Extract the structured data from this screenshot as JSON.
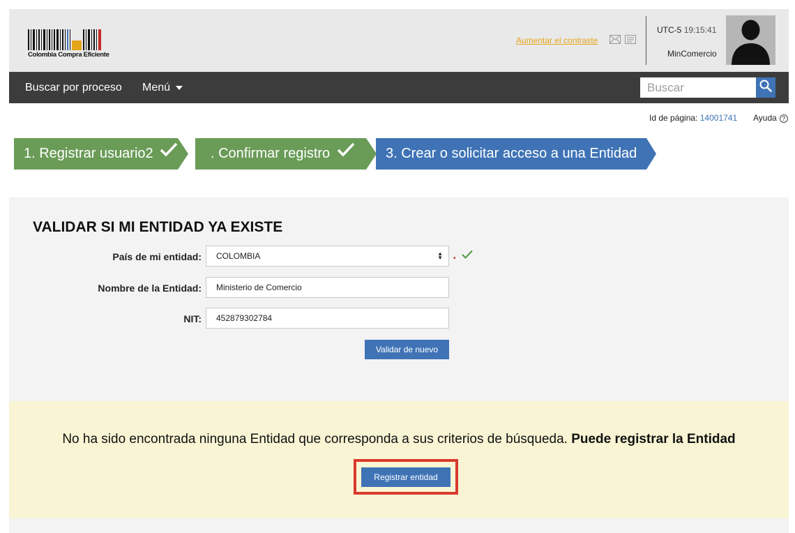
{
  "header": {
    "logo_text": "Colombia Compra Eficiente",
    "contrast_link": "Aumentar el contraste",
    "timezone": "UTC-5",
    "time": "19:15:41",
    "user_name": "MinComercio",
    "icons": [
      "mail-icon",
      "document-icon",
      "avatar-icon"
    ]
  },
  "nav": {
    "search_process": "Buscar por proceso",
    "menu": "Menú",
    "search_placeholder": "Buscar"
  },
  "page_info": {
    "page_id_label": "Id de página:",
    "page_id_value": "14001741",
    "help": "Ayuda"
  },
  "steps": [
    {
      "label": "1. Registrar usuario2",
      "status": "done",
      "color": "#6a9c58"
    },
    {
      "label": ". Confirmar registro",
      "status": "done",
      "color": "#6a9c58"
    },
    {
      "label": "3. Crear o solicitar acceso a una Entidad",
      "status": "current",
      "color": "#3f73b6"
    }
  ],
  "validate": {
    "title": "VALIDAR SI MI ENTIDAD YA EXISTE",
    "country_label": "País de mi entidad:",
    "country_value": "COLOMBIA",
    "entity_label": "Nombre de la Entidad:",
    "entity_value": "Ministerio de Comercio",
    "nit_label": "NIT:",
    "nit_value": "452879302784",
    "revalidate_button": "Validar de nuevo"
  },
  "result": {
    "message": "No ha sido encontrada ninguna Entidad que corresponda a sus criterios de búsqueda.",
    "message_bold": "Puede registrar la Entidad",
    "register_button": "Registrar entidad"
  },
  "colors": {
    "accent_blue": "#3f73b6",
    "step_green": "#6a9c58",
    "nav_dark": "#3c3c3c",
    "highlight_red": "#d93a2e",
    "result_bg": "#f9f4d4"
  }
}
